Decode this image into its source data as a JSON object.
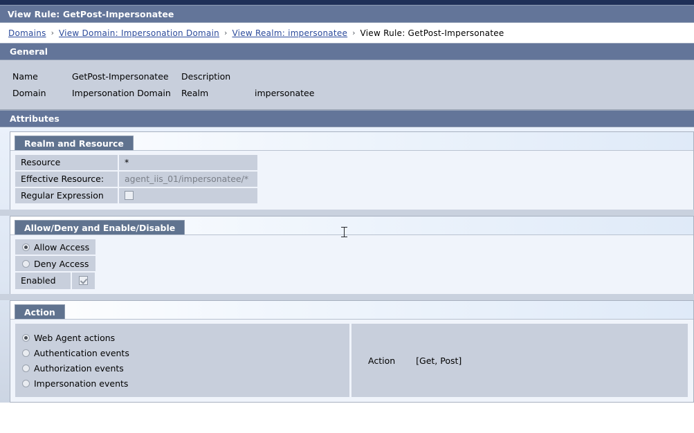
{
  "window": {
    "title": "View Rule: GetPost-Impersonatee"
  },
  "breadcrumb": {
    "separator": "›",
    "items": [
      {
        "label": "Domains",
        "link": true
      },
      {
        "label": "View Domain: Impersonation Domain",
        "link": true
      },
      {
        "label": "View Realm: impersonatee",
        "link": true
      },
      {
        "label": "View Rule: GetPost-Impersonatee",
        "link": false
      }
    ]
  },
  "general": {
    "header": "General",
    "rows": [
      {
        "label1": "Name",
        "value1": "GetPost-Impersonatee",
        "label2": "Description",
        "value2": ""
      },
      {
        "label1": "Domain",
        "value1": "Impersonation Domain",
        "label2": "Realm",
        "value2": "impersonatee"
      }
    ]
  },
  "attributes": {
    "header": "Attributes",
    "realm_and_resource": {
      "tab": "Realm and Resource",
      "fields": [
        {
          "label": "Resource",
          "value": "*",
          "type": "text",
          "readonly": false
        },
        {
          "label": "Effective Resource:",
          "value": "agent_iis_01/impersonatee/*",
          "type": "text",
          "readonly": true
        },
        {
          "label": "Regular Expression",
          "value": "",
          "type": "checkbox",
          "checked": false
        }
      ]
    },
    "allow_deny": {
      "tab": "Allow/Deny and Enable/Disable",
      "options": [
        {
          "label": "Allow Access",
          "selected": true
        },
        {
          "label": "Deny Access",
          "selected": false
        }
      ],
      "enabled": {
        "label": "Enabled",
        "checked": true
      }
    },
    "action": {
      "tab": "Action",
      "options": [
        {
          "label": "Web Agent actions",
          "selected": true
        },
        {
          "label": "Authentication events",
          "selected": false
        },
        {
          "label": "Authorization events",
          "selected": false
        },
        {
          "label": "Impersonation events",
          "selected": false
        }
      ],
      "action_label": "Action",
      "action_value": "[Get, Post]"
    }
  },
  "colors": {
    "header_bar": "#637599",
    "top_strip": "#1f3058",
    "field_bg": "#c8cfdc",
    "panel_bg": "#f0f4fb",
    "link": "#2b4a9b"
  }
}
